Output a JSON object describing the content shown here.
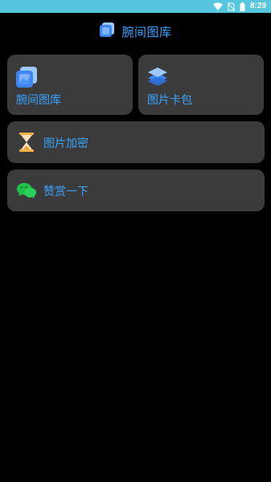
{
  "status_bar": {
    "time": "8:29",
    "background": "#56c6df",
    "icons": [
      "wifi-icon",
      "no-sim-icon",
      "battery-icon"
    ]
  },
  "header": {
    "title": "腕间图库",
    "icon": "gallery-icon"
  },
  "tiles": [
    {
      "label": "腕间图库",
      "icon": "gallery-icon"
    },
    {
      "label": "图片卡包",
      "icon": "layers-icon"
    },
    {
      "label": "图片加密",
      "icon": "hourglass-icon"
    },
    {
      "label": "赞赏一下",
      "icon": "wechat-icon"
    }
  ],
  "colors": {
    "background": "#000000",
    "tile": "#3b3b3b",
    "accent": "#3aa3ff"
  }
}
